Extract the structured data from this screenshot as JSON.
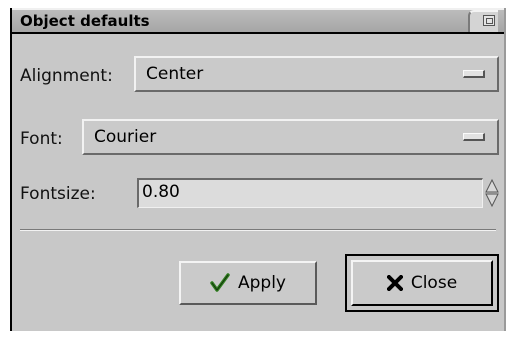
{
  "window": {
    "title": "Object defaults"
  },
  "form": {
    "alignment_label": "Alignment:",
    "alignment_value": "Center",
    "font_label": "Font:",
    "font_value": "Courier",
    "fontsize_label": "Fontsize:",
    "fontsize_value": "0.80"
  },
  "buttons": {
    "apply_label": "Apply",
    "close_label": "Close"
  },
  "icons": {
    "apply": "checkmark-icon",
    "close": "x-icon",
    "combo": "option-menu-indicator-icon",
    "spinner": "up-down-arrows-icon",
    "window": "window-tab-icon"
  },
  "colors": {
    "dialog_bg": "#c8c8c8",
    "apply_check": "#2e7d1e"
  }
}
